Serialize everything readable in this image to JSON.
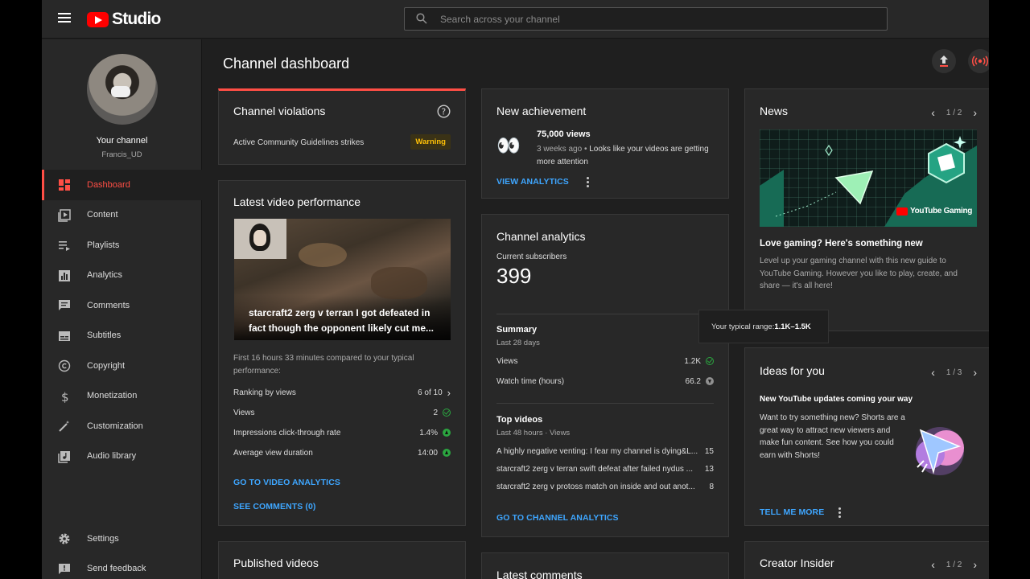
{
  "header": {
    "logo_text": "Studio",
    "search_placeholder": "Search across your channel"
  },
  "sidebar": {
    "channel_title": "Your channel",
    "channel_handle": "Francis_UD",
    "items": [
      {
        "label": "Dashboard",
        "icon": "dashboard-icon",
        "active": true
      },
      {
        "label": "Content",
        "icon": "content-icon"
      },
      {
        "label": "Playlists",
        "icon": "playlists-icon"
      },
      {
        "label": "Analytics",
        "icon": "analytics-icon"
      },
      {
        "label": "Comments",
        "icon": "comments-icon"
      },
      {
        "label": "Subtitles",
        "icon": "subtitles-icon"
      },
      {
        "label": "Copyright",
        "icon": "copyright-icon"
      },
      {
        "label": "Monetization",
        "icon": "dollar-icon"
      },
      {
        "label": "Customization",
        "icon": "wand-icon"
      },
      {
        "label": "Audio library",
        "icon": "audio-library-icon"
      }
    ],
    "bottom": [
      {
        "label": "Settings",
        "icon": "gear-icon"
      },
      {
        "label": "Send feedback",
        "icon": "feedback-icon"
      }
    ]
  },
  "main": {
    "title": "Channel dashboard",
    "violations": {
      "title": "Channel violations",
      "row_label": "Active Community Guidelines strikes",
      "badge": "Warning"
    },
    "latest_video": {
      "title": "Latest video performance",
      "video_title": "starcraft2 zerg v terran I got defeated in fact though the opponent likely cut me...",
      "note": "First 16 hours 33 minutes compared to your typical performance:",
      "rows": [
        {
          "label": "Ranking by views",
          "value": "6 of 10"
        },
        {
          "label": "Views",
          "value": "2"
        },
        {
          "label": "Impressions click-through rate",
          "value": "1.4%"
        },
        {
          "label": "Average view duration",
          "value": "14:00"
        }
      ],
      "link_analytics": "GO TO VIDEO ANALYTICS",
      "link_comments": "SEE COMMENTS (0)"
    },
    "published": {
      "title": "Published videos"
    },
    "achievement": {
      "title": "New achievement",
      "emoji": "👀",
      "headline": "75,000 views",
      "time": "3 weeks ago",
      "sep": "•",
      "desc_line1": "Looks like your videos are getting",
      "desc_line2": "more attention",
      "link": "VIEW ANALYTICS"
    },
    "analytics": {
      "title": "Channel analytics",
      "subs_label": "Current subscribers",
      "subs_value": "399",
      "summary_title": "Summary",
      "summary_period": "Last 28 days",
      "summary_rows": [
        {
          "label": "Views",
          "value": "1.2K"
        },
        {
          "label": "Watch time (hours)",
          "value": "66.2"
        }
      ],
      "top_title": "Top videos",
      "top_period": "Last 48 hours · Views",
      "top_videos": [
        {
          "title": "A highly negative venting: I fear my channel is dying&L...",
          "views": "15"
        },
        {
          "title": "starcraft2 zerg v terran swift defeat after failed nydus ...",
          "views": "13"
        },
        {
          "title": "starcraft2 zerg v protoss match on inside and out anot...",
          "views": "8"
        }
      ],
      "link": "GO TO CHANNEL ANALYTICS"
    },
    "latest_comments": {
      "title": "Latest comments"
    },
    "tooltip": {
      "label": "Your typical range:",
      "value": "1.1K–1.5K"
    },
    "news": {
      "title": "News",
      "pager": "1 / 2",
      "banner_brand": "YouTube Gaming",
      "headline": "Love gaming? Here's something new",
      "body": "Level up your gaming channel with this new guide to YouTube Gaming. However you like to play, create, and share — it's all here!"
    },
    "ideas": {
      "title": "Ideas for you",
      "pager": "1 / 3",
      "headline": "New YouTube updates coming your way",
      "body": "Want to try something new? Shorts are a great way to attract new viewers and make fun content. See how you could earn with Shorts!",
      "link": "TELL ME MORE"
    },
    "creator_insider": {
      "title": "Creator Insider",
      "pager": "1 / 2"
    }
  },
  "colors": {
    "accent": "#ff4e45",
    "link": "#3ea6ff",
    "success": "#2ba640",
    "warning": "#ffc107"
  }
}
